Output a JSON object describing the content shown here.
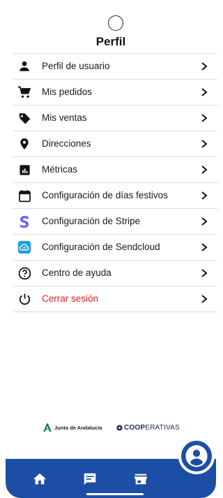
{
  "header": {
    "title": "Perfil"
  },
  "menu": [
    {
      "label": "Perfil de usuario",
      "icon": "person-icon"
    },
    {
      "label": "Mis pedidos",
      "icon": "cart-icon"
    },
    {
      "label": "Mis ventas",
      "icon": "tag-icon"
    },
    {
      "label": "Direcciones",
      "icon": "location-pin-icon"
    },
    {
      "label": "Métricas",
      "icon": "metrics-icon"
    },
    {
      "label": "Configuración de días festivos",
      "icon": "calendar-icon"
    },
    {
      "label": "Configuración de Stripe",
      "icon": "stripe-icon"
    },
    {
      "label": "Configuración de Sendcloud",
      "icon": "sendcloud-icon"
    },
    {
      "label": "Centro de ayuda",
      "icon": "help-icon"
    },
    {
      "label": "Cerrar sesión",
      "icon": "power-icon"
    }
  ],
  "footer": {
    "junta_label": "Junta de Andalucía",
    "coop_bold": "COOP",
    "coop_light": "ERATIVAS"
  },
  "nav": [
    "home-icon",
    "chat-icon",
    "store-icon",
    "profile-icon"
  ],
  "colors": {
    "nav": "#1d4ea6",
    "logout": "#e0201b",
    "divider": "#cfe0e2",
    "stripe": "#635bff",
    "sendcloud": "#1ea0e0"
  }
}
